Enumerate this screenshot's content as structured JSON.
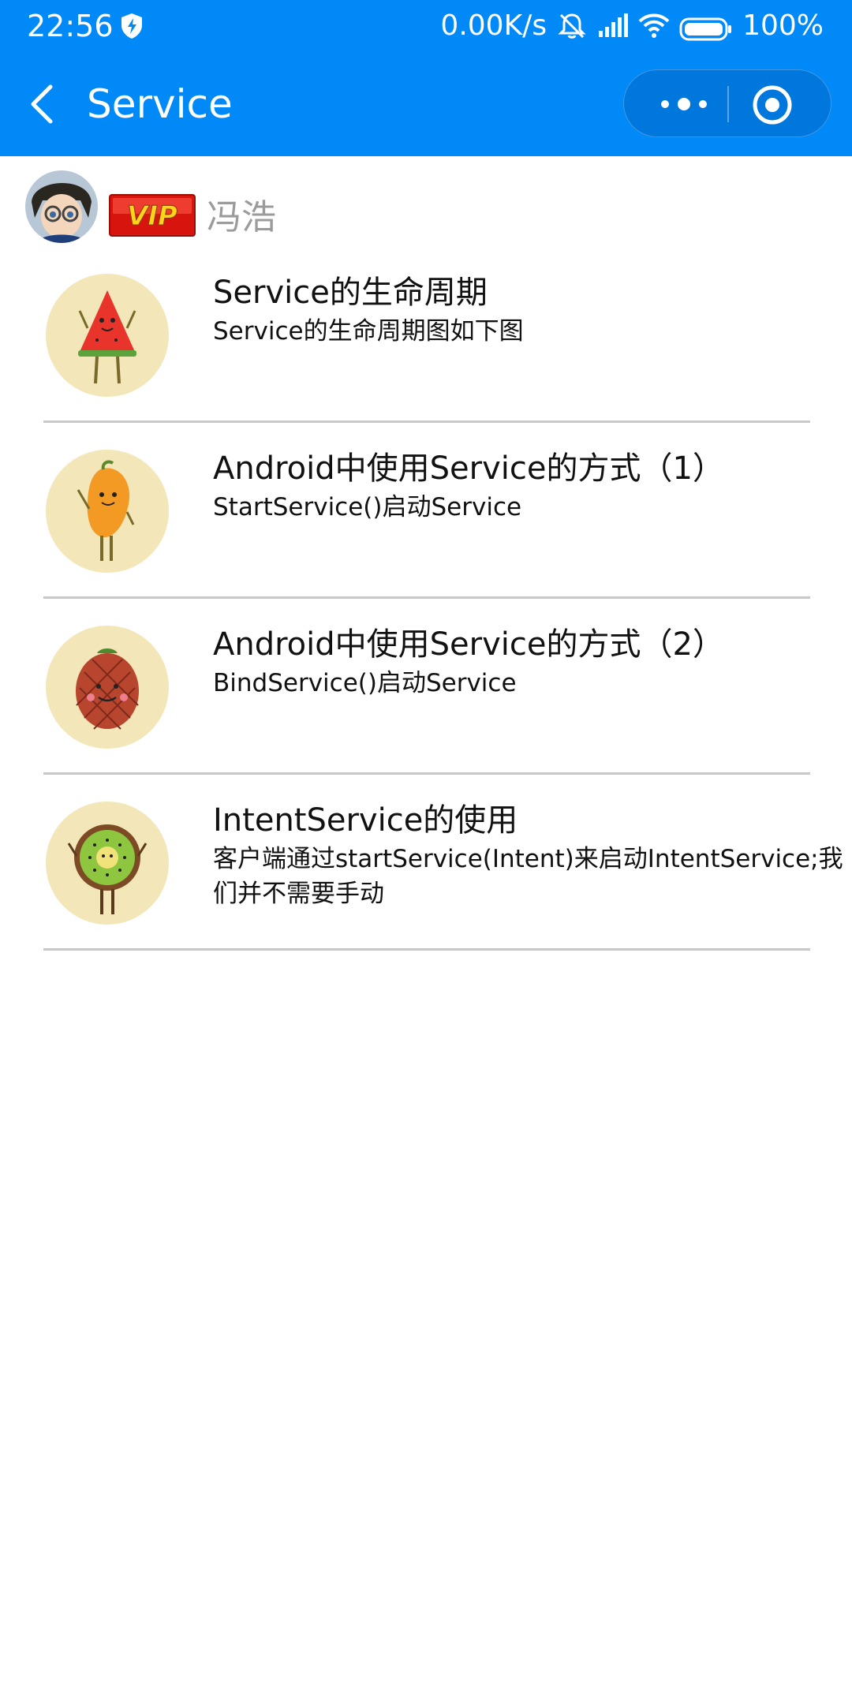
{
  "status_bar": {
    "time": "22:56",
    "network_speed": "0.00K/s",
    "battery": "100%",
    "icons": [
      "shield-icon",
      "mute-bell-icon",
      "signal-icon",
      "wifi-icon",
      "battery-icon"
    ]
  },
  "nav": {
    "title": "Service",
    "back_icon": "chevron-left-icon",
    "more_icon": "more-dots-icon",
    "close_icon": "target-close-icon"
  },
  "user": {
    "name": "冯浩",
    "badge": "VIP"
  },
  "items": [
    {
      "title": " Service的生命周期",
      "desc": "Service的生命周期图如下图",
      "thumb": "watermelon"
    },
    {
      "title": "Android中使用Service的方式（1）",
      "desc": "StartService()启动Service",
      "thumb": "mango"
    },
    {
      "title": "Android中使用Service的方式（2）",
      "desc": "BindService()启动Service",
      "thumb": "lychee"
    },
    {
      "title": "IntentService的使用",
      "desc": "客户端通过startService(Intent)来启动IntentService;我们并不需要手动",
      "thumb": "kiwi"
    }
  ],
  "colors": {
    "header_bg": "#0089f7",
    "capsule_bg": "#0077dd",
    "thumb_bg": "#f3e6b8",
    "divider": "#c8c8c8",
    "username": "#9b9b9b"
  }
}
